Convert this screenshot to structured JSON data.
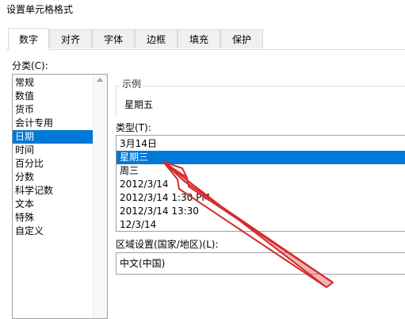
{
  "dialog": {
    "title": "设置单元格格式"
  },
  "tabs": [
    {
      "label": "数字",
      "active": true
    },
    {
      "label": "对齐",
      "active": false
    },
    {
      "label": "字体",
      "active": false
    },
    {
      "label": "边框",
      "active": false
    },
    {
      "label": "填充",
      "active": false
    },
    {
      "label": "保护",
      "active": false
    }
  ],
  "category": {
    "label": "分类(C):",
    "items": [
      "常规",
      "数值",
      "货币",
      "会计专用",
      "日期",
      "时间",
      "百分比",
      "分数",
      "科学记数",
      "文本",
      "特殊",
      "自定义"
    ],
    "selected": "日期"
  },
  "sample": {
    "legend": "示例",
    "value": "星期五"
  },
  "type": {
    "label": "类型(T):",
    "items": [
      "3月14日",
      "星期三",
      "周三",
      "2012/3/14",
      "2012/3/14 1:30 PM",
      "2012/3/14 13:30",
      "12/3/14"
    ],
    "selected": "星期三"
  },
  "region": {
    "label": "区域设置(国家/地区)(L):",
    "value": "中文(中国)"
  },
  "colors": {
    "selection": "#0078d7",
    "annotation_arrow": "#d42a2a"
  }
}
